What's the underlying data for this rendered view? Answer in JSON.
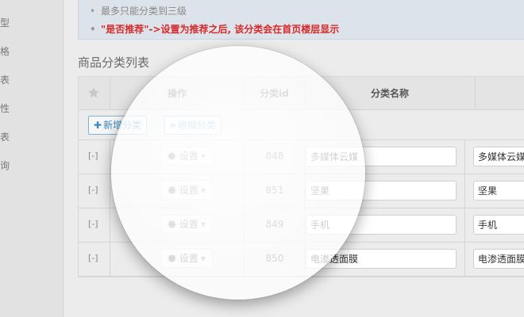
{
  "sidebar": {
    "items": [
      "型",
      "格",
      "表",
      "性",
      "表",
      "询"
    ]
  },
  "tips": {
    "line1": "最多只能分类到三级",
    "line2": "\"是否推荐\"->设置为推荐之后, 该分类会在首页楼层显示",
    "bullet": "•"
  },
  "section": {
    "title": "商品分类列表"
  },
  "table": {
    "headers": {
      "action": "操作",
      "id": "分类id",
      "name": "分类名称"
    },
    "toolbar": {
      "add_label": "新增分类",
      "add_icon": "plus-icon",
      "collapse_label": "收缩分类",
      "collapse_icon": "double-chevron-up-icon"
    },
    "rows": [
      {
        "toggle": "[-]",
        "set_label": "设置",
        "id": "848",
        "name": "多媒体云媒",
        "name2": "多媒体云媒"
      },
      {
        "toggle": "[-]",
        "set_label": "设置",
        "id": "851",
        "name": "坚果",
        "name2": "坚果"
      },
      {
        "toggle": "[-]",
        "set_label": "设置",
        "id": "849",
        "name": "手机",
        "name2": "手机"
      },
      {
        "toggle": "[-]",
        "set_label": "设置",
        "id": "850",
        "name": "电渗透面膜",
        "name2": "电渗透面膜"
      }
    ]
  },
  "colors": {
    "accent": "#3a8ac0",
    "warning": "#d62a2a",
    "background": "#ececec"
  }
}
